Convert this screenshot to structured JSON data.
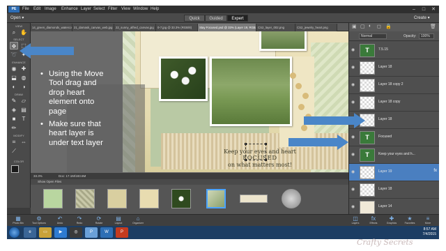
{
  "app": {
    "logo": "PE",
    "menu": [
      "File",
      "Edit",
      "Image",
      "Enhance",
      "Layer",
      "Select",
      "Filter",
      "View",
      "Window",
      "Help"
    ],
    "window_controls": [
      "–",
      "□",
      "✕"
    ]
  },
  "modebar": {
    "open_label": "Open ▾",
    "modes": [
      "Quick",
      "Guided",
      "Expert"
    ],
    "active_mode": "Expert",
    "create_label": "Create ▾"
  },
  "toolbox": {
    "sections": [
      "VIEW",
      "SELECT",
      "ENHANCE",
      "DRAW",
      "MODIFY",
      "COLOR"
    ]
  },
  "tabs": [
    "14_green_diamonds_watercolor.jpg",
    "21_damask_canvas_web.jpg",
    "22_sunny_alfred_canvas.jpg",
    "0-7.jpg @ 33.3% (RGB/8)",
    "Stay Focused.psd @ 33% (Layer 19, RGB/8)",
    "CS2_layer_002.png",
    "CS2_jewelry_heart.png"
  ],
  "active_tab_index": 4,
  "canvas": {
    "title_text_line1": "Keep your eyes and heart",
    "title_text_line2": "FOCUSED",
    "title_text_line3": "on what matters most!"
  },
  "slide_text": {
    "bullet1": "Using the Move Tool drag and drop heart element onto page",
    "bullet2": "Make sure that heart layer is under text layer",
    "bullet_char": "•"
  },
  "status": {
    "zoom": "33.3%",
    "doc": "Doc: 17.1M/183.6M"
  },
  "bin": {
    "header": "Show Open Files",
    "selected_index": 5
  },
  "layers_panel": {
    "blend_mode": "Normal",
    "opacity_label": "Opacity:",
    "opacity_value": "100%",
    "layers": [
      {
        "name": "7.5.15",
        "type": "text"
      },
      {
        "name": "Layer 18",
        "type": "image"
      },
      {
        "name": "Layer 18 copy 2",
        "type": "image"
      },
      {
        "name": "Layer 18 copy",
        "type": "image"
      },
      {
        "name": "Layer 18",
        "type": "image"
      },
      {
        "name": "Focused",
        "type": "text"
      },
      {
        "name": "Keep your eyes and h...",
        "type": "text"
      },
      {
        "name": "Layer 19",
        "type": "image"
      },
      {
        "name": "Layer 18",
        "type": "image"
      },
      {
        "name": "Layer 14",
        "type": "image"
      },
      {
        "name": "Layer 14",
        "type": "image"
      }
    ],
    "selected_index": 7
  },
  "bottom_toolbar": {
    "left": [
      "Photo Bin",
      "Tool Options",
      "Undo",
      "Redo",
      "Rotate",
      "Layout",
      "Organizer"
    ],
    "right": [
      "Layers",
      "Effects",
      "Graphics",
      "Favorites",
      "More"
    ]
  },
  "taskbar": {
    "time": "8:57 AM",
    "date": "7/4/2015"
  },
  "watermark": "Crafty Secrets",
  "colors": {
    "arrow": "#4a86c8",
    "selection": "#4a7fc0"
  }
}
